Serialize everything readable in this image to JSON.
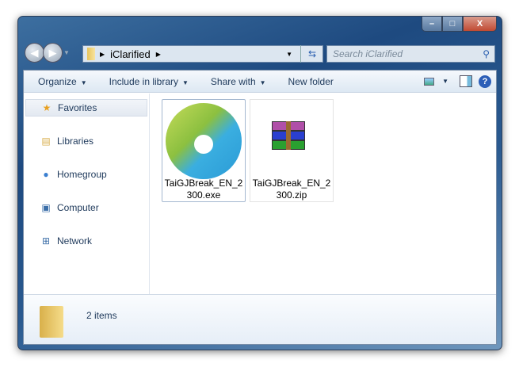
{
  "window": {
    "min": "–",
    "max": "□",
    "close": "X"
  },
  "address": {
    "crumbs": [
      "iClarified"
    ],
    "search_placeholder": "Search iClarified"
  },
  "toolbar": {
    "organize": "Organize",
    "include": "Include in library",
    "share": "Share with",
    "new_folder": "New folder"
  },
  "sidebar": {
    "items": [
      {
        "label": "Favorites"
      },
      {
        "label": "Libraries"
      },
      {
        "label": "Homegroup"
      },
      {
        "label": "Computer"
      },
      {
        "label": "Network"
      }
    ]
  },
  "files": [
    {
      "name": "TaiGJBreak_EN_2300.exe",
      "line1": "TaiGJBreak_EN_2",
      "line2": "300.exe"
    },
    {
      "name": "TaiGJBreak_EN_2300.zip",
      "line1": "TaiGJBreak_EN_2",
      "line2": "300.zip"
    }
  ],
  "details": {
    "count": "2 items"
  }
}
